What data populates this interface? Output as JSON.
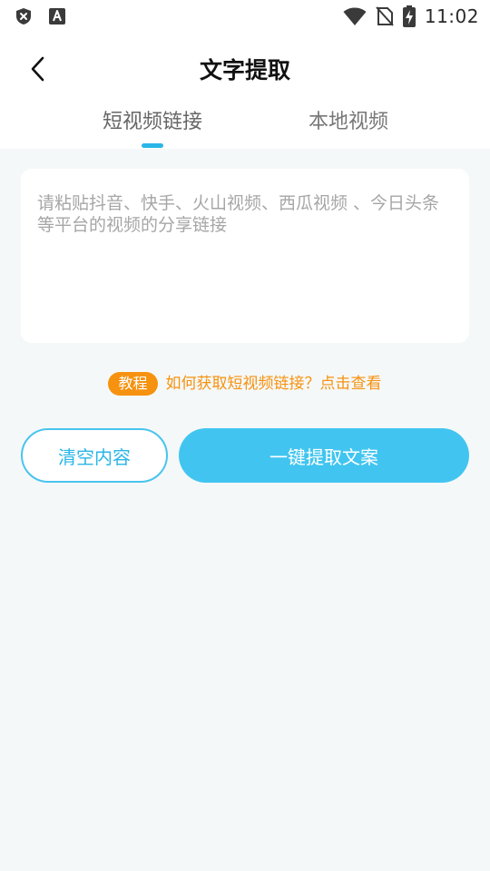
{
  "status_bar": {
    "time": "11:02",
    "icons": [
      "shield-x-icon",
      "font-a-icon",
      "wifi-icon",
      "no-sim-icon",
      "battery-charging-icon"
    ]
  },
  "app_bar": {
    "back_icon": "chevron-left-icon",
    "title": "文字提取"
  },
  "tabs": [
    {
      "label": "短视频链接",
      "active": true
    },
    {
      "label": "本地视频",
      "active": false
    }
  ],
  "input": {
    "value": "",
    "placeholder": "请粘贴抖音、快手、火山视频、西瓜视频 、今日头条等平台的视频的分享链接"
  },
  "tutorial": {
    "badge": "教程",
    "link_text": "如何获取短视频链接？点击查看"
  },
  "buttons": {
    "clear_label": "清空内容",
    "extract_label": "一键提取文案"
  },
  "colors": {
    "accent": "#41c5f0",
    "accent_border": "#48c4ee",
    "tab_indicator": "#29b6e8",
    "tutorial_orange": "#f6920f",
    "background": "#f5f8f9"
  }
}
